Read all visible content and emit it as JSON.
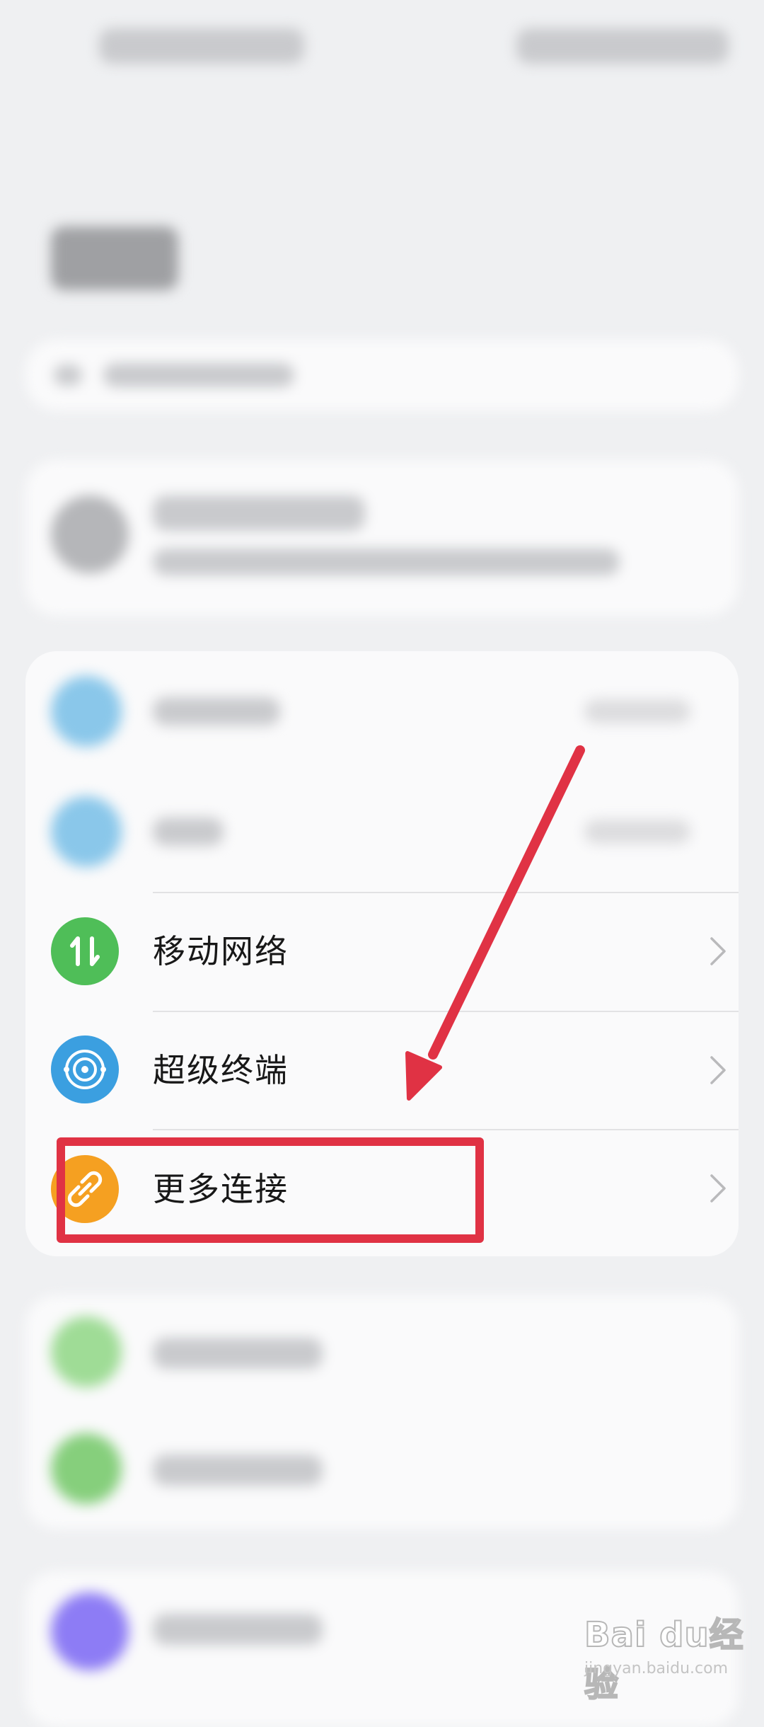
{
  "settings_list": {
    "items": [
      {
        "id": "mobile-network",
        "label": "移动网络",
        "icon": "arrows-updown-icon",
        "color": "#4fbe58"
      },
      {
        "id": "super-device",
        "label": "超级终端",
        "icon": "super-device-icon",
        "color": "#3b9fe0"
      },
      {
        "id": "more-connections",
        "label": "更多连接",
        "icon": "link-icon",
        "color": "#f5a021"
      }
    ]
  },
  "colors": {
    "highlight_box": "#e03244",
    "arrow": "#e03244",
    "background": "#eff0f2",
    "card": "#fafafb"
  }
}
